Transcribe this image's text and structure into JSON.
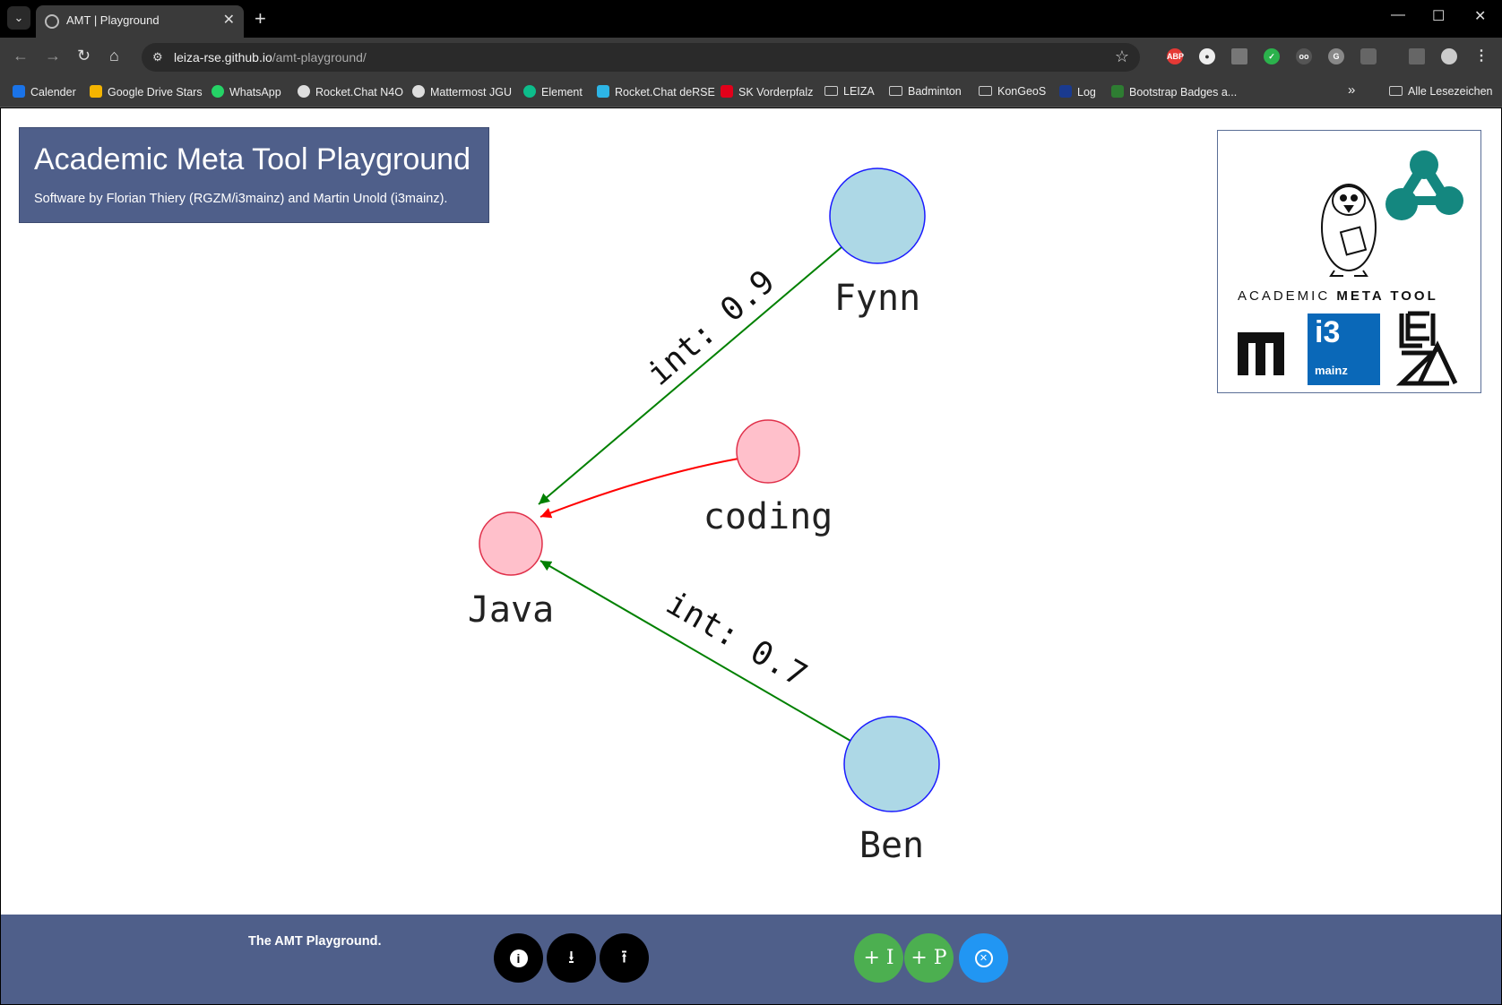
{
  "browser": {
    "tab_title": "AMT | Playground",
    "url_host": "leiza-rse.github.io",
    "url_path": "/amt-playground/",
    "bookmarks": [
      {
        "label": "Calender",
        "color": "#1a73e8"
      },
      {
        "label": "Google Drive Stars",
        "color": "#f4b400"
      },
      {
        "label": "WhatsApp",
        "color": "#25d366"
      },
      {
        "label": "Rocket.Chat N4O",
        "color": "#dddddd"
      },
      {
        "label": "Mattermost JGU",
        "color": "#dddddd"
      },
      {
        "label": "Element",
        "color": "#0dbd8b"
      },
      {
        "label": "Rocket.Chat deRSE",
        "color": "#2db5e6"
      },
      {
        "label": "SK Vorderpfalz",
        "color": "#e2001a"
      },
      {
        "label": "LEIZA",
        "folder": true
      },
      {
        "label": "Badminton",
        "folder": true
      },
      {
        "label": "KonGeoS",
        "folder": true
      },
      {
        "label": "Log",
        "color": "#1a3a8f"
      },
      {
        "label": "Bootstrap Badges a...",
        "color": "#2e7d32"
      }
    ],
    "all_bookmarks": "Alle Lesezeichen"
  },
  "header": {
    "title": "Academic Meta Tool Playground",
    "subtitle": "Software by Florian Thiery (RGZM/i3mainz) and Martin Unold (i3mainz)."
  },
  "graph": {
    "nodes": [
      {
        "id": "fynn",
        "label": "Fynn",
        "kind": "individual",
        "color": "#add8e6",
        "stroke": "#1a1aff"
      },
      {
        "id": "coding",
        "label": "coding",
        "kind": "concept",
        "color": "#ffc0cb",
        "stroke": "#e0304a"
      },
      {
        "id": "java",
        "label": "Java",
        "kind": "concept",
        "color": "#ffc0cb",
        "stroke": "#e0304a"
      },
      {
        "id": "ben",
        "label": "Ben",
        "kind": "individual",
        "color": "#add8e6",
        "stroke": "#1a1aff"
      }
    ],
    "edges": [
      {
        "from": "fynn",
        "to": "java",
        "label": "int: 0.9",
        "color": "#008000"
      },
      {
        "from": "coding",
        "to": "java",
        "label": "",
        "color": "#ff0000"
      },
      {
        "from": "ben",
        "to": "java",
        "label": "int: 0.7",
        "color": "#008000"
      }
    ]
  },
  "logos": {
    "amt_text_light": "ACADEMIC ",
    "amt_text_bold": "META TOOL",
    "i3_top": "i3",
    "i3_bottom": "mainz"
  },
  "footer": {
    "text": "The AMT Playground.",
    "buttons": {
      "info": "i",
      "plus_i": "+ I",
      "plus_p": "+ P"
    }
  }
}
